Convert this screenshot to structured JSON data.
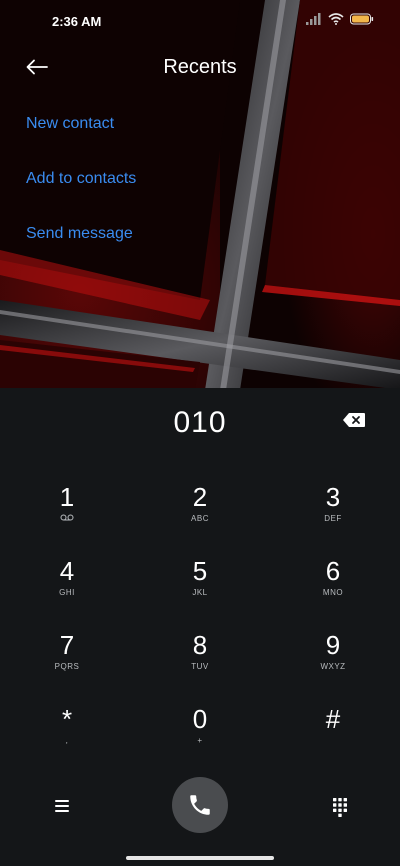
{
  "status_bar": {
    "time": "2:36 AM",
    "icons": [
      "signal-icon",
      "wifi-icon",
      "battery-icon"
    ]
  },
  "header": {
    "title": "Recents",
    "back_icon": "arrow-left-icon"
  },
  "actions": [
    {
      "label": "New contact"
    },
    {
      "label": "Add to contacts"
    },
    {
      "label": "Send message"
    }
  ],
  "dialer": {
    "number": "010",
    "keys": [
      {
        "digit": "1",
        "letters": ""
      },
      {
        "digit": "2",
        "letters": "ABC"
      },
      {
        "digit": "3",
        "letters": "DEF"
      },
      {
        "digit": "4",
        "letters": "GHI"
      },
      {
        "digit": "5",
        "letters": "JKL"
      },
      {
        "digit": "6",
        "letters": "MNO"
      },
      {
        "digit": "7",
        "letters": "PQRS"
      },
      {
        "digit": "8",
        "letters": "TUV"
      },
      {
        "digit": "9",
        "letters": "WXYZ"
      },
      {
        "digit": "*",
        "letters": ","
      },
      {
        "digit": "0",
        "letters": "+"
      },
      {
        "digit": "#",
        "letters": ""
      }
    ],
    "bottom_icons": [
      "menu-icon",
      "phone-icon",
      "dialpad-icon"
    ]
  },
  "colors": {
    "link": "#3a8cf0",
    "background": "#141618",
    "call_button": "#4a4c4f",
    "accent_red": "#d10f0f"
  }
}
